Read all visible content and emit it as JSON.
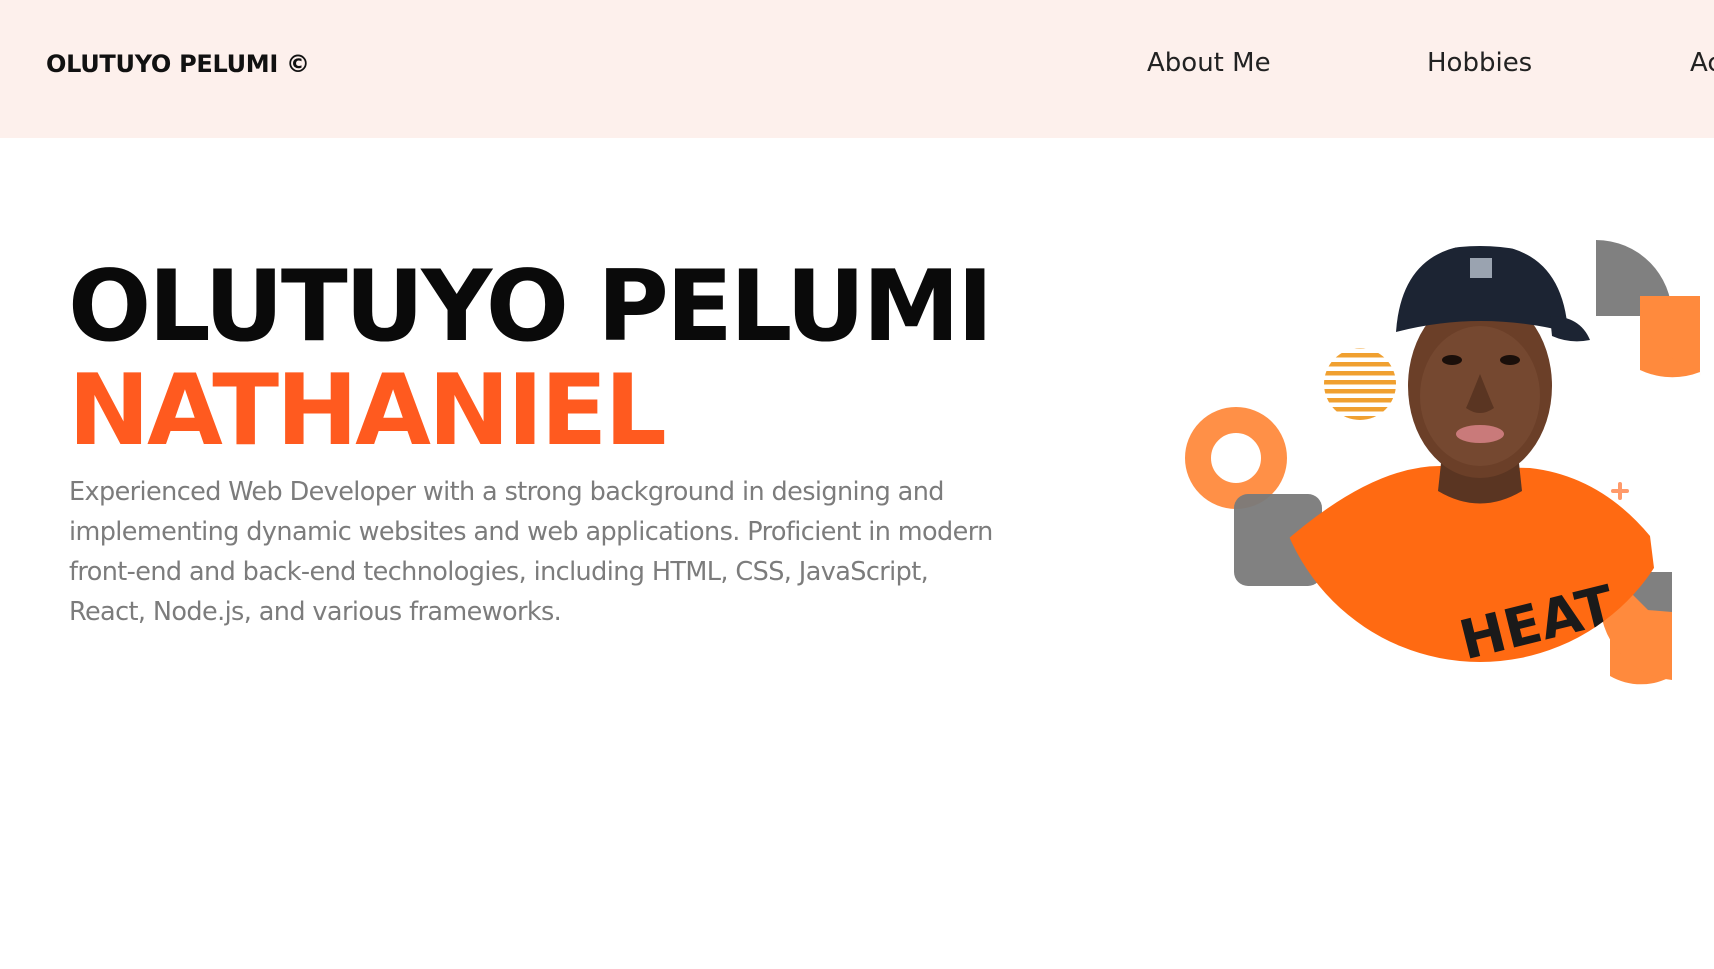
{
  "nav": {
    "brand": "OLUTUYO PELUMI ©",
    "links": [
      {
        "label": "About Me"
      },
      {
        "label": "Hobbies"
      },
      {
        "label": "Ac"
      }
    ]
  },
  "hero": {
    "title": "OLUTUYO PELUMI",
    "subtitle": "NATHANIEL",
    "bio": "Experienced Web Developer with a strong background in designing and implementing dynamic websites and web applications. Proficient in modern front-end and back-end technologies, including HTML, CSS, JavaScript, React, Node.js, and various frameworks."
  },
  "colors": {
    "nav_background": "#fdf0ec",
    "accent": "#ff5a1f",
    "accent_light": "#ff8a3d",
    "gray_shape": "#808080",
    "stripes": "#f0a030",
    "text_dark": "#0a0a0a",
    "text_muted": "#7c7c7c"
  },
  "icons": {
    "profile": "profile-photo"
  }
}
